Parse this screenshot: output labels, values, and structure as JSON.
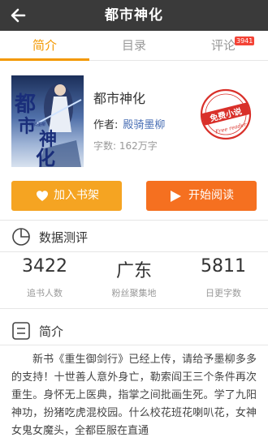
{
  "topbar": {
    "title": "都市神化",
    "back_icon": "back-arrow-icon"
  },
  "tabs": [
    {
      "label": "简介",
      "active": true
    },
    {
      "label": "目录",
      "active": false
    },
    {
      "label": "评论",
      "active": false,
      "badge": "3941"
    }
  ],
  "book": {
    "cover_title": "都市神化",
    "cover_author": "殿骑墨柳",
    "title": "都市神化",
    "author_label": "作者:",
    "author": "殿骑墨柳",
    "wordcount": "字数: 162万字",
    "stamp_text": "免费小说",
    "stamp_sub": "Free reader"
  },
  "actions": {
    "shelf_label": "加入书架",
    "read_label": "开始阅读"
  },
  "stats_section": {
    "title": "数据测评",
    "items": [
      {
        "value": "3422",
        "label": "追书人数"
      },
      {
        "value": "广东",
        "label": "粉丝聚集地"
      },
      {
        "value": "5811",
        "label": "日更字数"
      }
    ]
  },
  "intro_section": {
    "title": "简介",
    "text": "新书《重生御剑行》已经上传，请给予墨柳多多的支持！十世善人意外身亡，勒索阎王三个条件再次重生。身怀无上医典，指掌之间批画生死。学了九阳神功，扮猪吃虎混校园。什么校花班花喇叭花，女神女鬼女魔头，全都臣服在直通"
  },
  "colors": {
    "topbar": "#3a3a3a",
    "accent": "#f39800",
    "shelf_button": "#f5a422",
    "read_button": "#f57020",
    "author_link": "#4a6fb5",
    "badge": "#f44336",
    "stamp": "#d9302a"
  }
}
